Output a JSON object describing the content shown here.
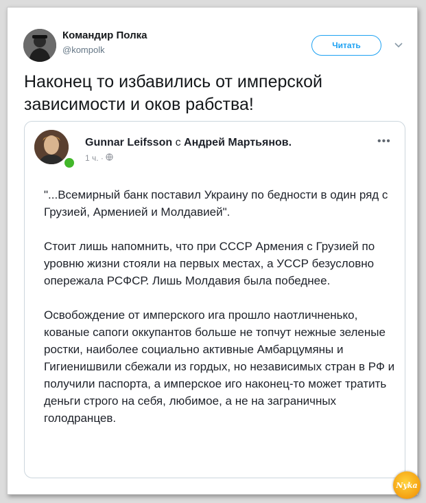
{
  "tweet": {
    "author_name": "Командир Полка",
    "author_handle": "@kompolk",
    "follow_label": "Читать",
    "text": "Наконец то избавились от имперской зависимости и оков рабства!"
  },
  "quoted_post": {
    "author": "Gunnar Leifsson",
    "with_word": "с",
    "tagged": "Андрей Мартьянов.",
    "time": "1 ч. ·",
    "more": "•••",
    "paragraphs": [
      "\"...Всемирный банк поставил Украину по бедности в один ряд с Грузией, Арменией и Молдавией\".",
      "Стоит лишь напомнить, что при СССР Армения с Грузией по уровню жизни стояли на первых местах, а УССР безусловно опережала РСФСР. Лишь Молдавия была победнее.",
      "Освобождение от имперского ига прошло наотличненько, кованые сапоги оккупантов больше не топчут нежные зеленые ростки, наиболее социально активные Амбарцумяны и Гигиенишвили сбежали из гордых, но независимых стран в РФ и получили паспорта, а имперское иго наконец-то может тратить деньги строго на себя, любимое, а не на заграничных голодранцев."
    ]
  },
  "watermark_text": "Nyka",
  "colors": {
    "accent": "#1da1f2",
    "online": "#42b72a"
  },
  "icons": {
    "chevron": "chevron-down-icon",
    "globe": "globe-icon"
  }
}
